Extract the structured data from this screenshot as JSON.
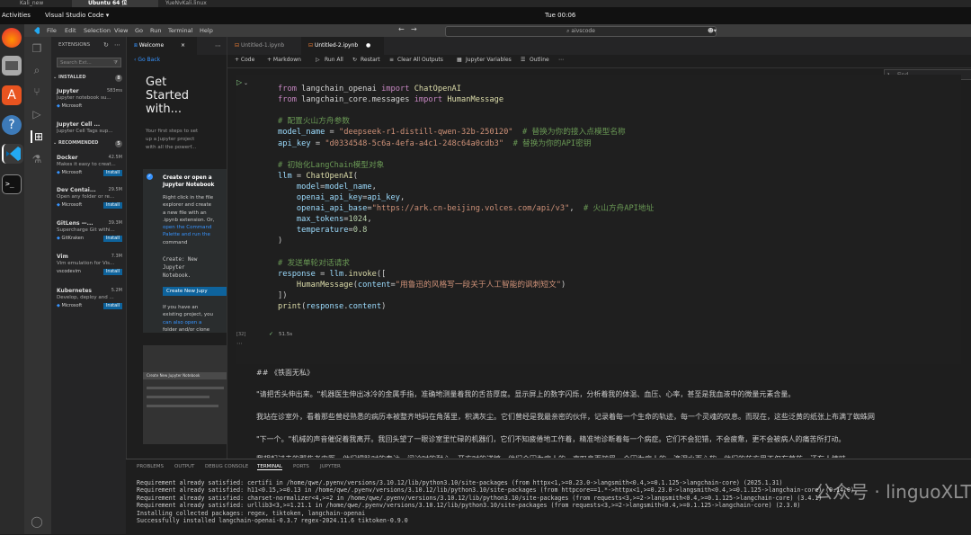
{
  "host_tabs": [
    "Kali_new",
    "Ubuntu 64 位",
    "YueNvKali.linux"
  ],
  "gnome": {
    "activities": "Activities",
    "app": "Visual Studio Code ▾",
    "clock": "Tue 00:06"
  },
  "menu": [
    "File",
    "Edit",
    "Selection",
    "View",
    "Go",
    "Run",
    "Terminal",
    "Help"
  ],
  "command_center": "aivscode",
  "sidebar": {
    "title": "EXTENSIONS",
    "search_placeholder": "Search Ext...",
    "installed_label": "INSTALLED",
    "installed_count": "8",
    "installed": [
      {
        "name": "Jupyter",
        "meta": "583ms",
        "desc": "Jupyter notebook su...",
        "publisher": "Microsoft"
      },
      {
        "name": "Jupyter Cell ...",
        "meta": "",
        "desc": "Jupyter Cell Tags sup...",
        "publisher": ""
      }
    ],
    "recommended_label": "RECOMMENDED",
    "recommended_count": "5",
    "recommended": [
      {
        "name": "Docker",
        "meta": "42.5M",
        "desc": "Makes it easy to creat...",
        "publisher": "Microsoft",
        "install": "Install"
      },
      {
        "name": "Dev Contai...",
        "meta": "29.5M",
        "desc": "Open any folder or re...",
        "publisher": "Microsoft",
        "install": "Install"
      },
      {
        "name": "GitLens —...",
        "meta": "39.3M",
        "desc": "Supercharge Git withi...",
        "publisher": "GitKraken",
        "install": "Install"
      },
      {
        "name": "Vim",
        "meta": "7.3M",
        "desc": "Vim emulation for Vis...",
        "publisher": "vscodevim",
        "install": "Install"
      },
      {
        "name": "Kubernetes",
        "meta": "5.2M",
        "desc": "Develop, deploy and ...",
        "publisher": "Microsoft",
        "install": "Install"
      }
    ]
  },
  "welcome": {
    "tab": "Welcome",
    "go_back": "Go Back",
    "heading": [
      "Get",
      "Started",
      "with..."
    ],
    "intro": [
      "Your first steps to set",
      "up a Jupyter project",
      "with all the powerf..."
    ],
    "card_title": [
      "Create or open a",
      "Jupyter Notebook"
    ],
    "card_body": [
      "Right click in the file",
      "explorer and create",
      "a new file with an",
      ".ipynb extension. Or,",
      "open the Command",
      "Palette and run the",
      "command"
    ],
    "code_text": [
      "Create: New",
      "Jupyter",
      "Notebook."
    ],
    "create_button": "Create New Jupy",
    "footer": [
      "If you have an",
      "existing project, you",
      "can also open a",
      "folder and/or clone"
    ],
    "thumb_title": "Create New Jupyter Notebook"
  },
  "editor": {
    "tabs": [
      "Untitled-1.ipynb",
      "Untitled-2.ipynb"
    ],
    "toolbar": [
      "+ Code",
      "+ Markdown",
      "Run All",
      "Restart",
      "Clear All Outputs",
      "Jupyter Variables",
      "Outline"
    ],
    "find_placeholder": "Find",
    "exec_count": "[32]",
    "exec_time": "51.5s",
    "code_lines": [
      "from langchain_openai import ChatOpenAI",
      "from langchain_core.messages import HumanMessage",
      "",
      "# 配置火山方舟参数",
      "model_name = \"deepseek-r1-distill-qwen-32b-250120\"  # 替换为你的接入点模型名称",
      "api_key = \"d0334548-5c6a-4efa-a4c1-248c64a0cdb3\"  # 替换为你的API密钥",
      "",
      "# 初始化LangChain模型对象",
      "llm = ChatOpenAI(",
      "    model=model_name,",
      "    openai_api_key=api_key,",
      "    openai_api_base=\"https://ark.cn-beijing.volces.com/api/v3\",  # 火山方舟API地址",
      "    max_tokens=1024,",
      "    temperature=0.8",
      ")",
      "",
      "# 发送单轮对话请求",
      "response = llm.invoke([",
      "    HumanMessage(content=\"用鲁迅的风格写一段关于人工智能的讽刺短文\")",
      "])",
      "print(response.content)"
    ],
    "output": [
      "##  《铁面无私》",
      "\"请把舌头伸出来。\"机器医生伸出冰冷的金属手指，准确地测量着我的舌苔厚度。显示屏上的数字闪烁，分析着我的体温、血压、心率，甚至是我血液中的微量元素含量。",
      "我站在诊室外，看着那些曾经熟悉的病历本被整齐地码在角落里，积满灰尘。它们曾经是我最亲密的伙伴，记录着每一个生命的轨迹，每一个灵魂的叹息。而现在，这些泛黄的纸张上布满了蜘蛛网",
      "\"下一个。\"机械的声音催促着我离开。我回头望了一眼诊室里忙碌的机器们，它们不知疲倦地工作着，精准地诊断着每一个病症。它们不会犯错，不会疲惫，更不会被病人的痛苦所打动。",
      "我想起过去的那些老中医，他们把脉时的专注，问诊时的耐心，开方时的谨慎。他们会因为病人的一声叹息而皱眉，会因为病人的一滴泪水而心软，他们的药方里不仅有草药，还有人情味。"
    ]
  },
  "panel": {
    "tabs": [
      "PROBLEMS",
      "OUTPUT",
      "DEBUG CONSOLE",
      "TERMINAL",
      "PORTS",
      "JUPYTER"
    ],
    "terminal": [
      "Requirement already satisfied: certifi in /home/qwe/.pyenv/versions/3.10.12/lib/python3.10/site-packages (from httpx<1,>=0.23.0->langsmith<0.4,>=0.1.125->langchain-core) (2025.1.31)",
      "Requirement already satisfied: h11<0.15,>=0.13 in /home/qwe/.pyenv/versions/3.10.12/lib/python3.10/site-packages (from httpcore==1.*->httpx<1,>=0.23.0->langsmith<0.4,>=0.1.125->langchain-core) (0.14.0)",
      "Requirement already satisfied: charset-normalizer<4,>=2 in /home/qwe/.pyenv/versions/3.10.12/lib/python3.10/site-packages (from requests<3,>=2->langsmith<0.4,>=0.1.125->langchain-core) (3.4.1)",
      "Requirement already satisfied: urllib3<3,>=1.21.1 in /home/qwe/.pyenv/versions/3.10.12/lib/python3.10/site-packages (from requests<3,>=2->langsmith<0.4,>=0.1.125->langchain-core) (2.3.0)",
      "Installing collected packages: regex, tiktoken, langchain-openai",
      "Successfully installed langchain-openai-0.3.7 regex-2024.11.6 tiktoken-0.9.0"
    ],
    "watermark": "公众号 · linguoXLT"
  },
  "colors": {
    "accent": "#0e639c",
    "keyword": "#c586c0",
    "string": "#ce9178",
    "comment": "#6a9955",
    "variable": "#9cdcfe",
    "function": "#dcdcaa"
  }
}
